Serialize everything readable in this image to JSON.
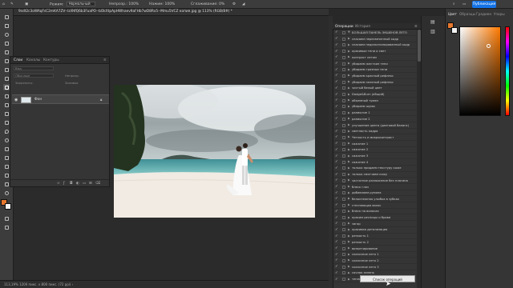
{
  "options_bar": {
    "mode_label": "Режим:",
    "mode_value": "Нормальный",
    "opacity_label": "Непрозр.:",
    "opacity_value": "100%",
    "flow_label": "Нажим:",
    "flow_value": "100%",
    "smoothing_label": "Сглаживание:",
    "smoothing_value": "0%",
    "publish_label": "Публикация"
  },
  "document": {
    "tab_title": "9sdt2c3oWAqFsC2mKA7ZV--lzi9tfQ6b3FuaPO--bOkXtpApHWhaev9aFHb7wD8Rx5--Mmu5VCZ копия.jpg @ 113% (RGB/8#) *"
  },
  "status_bar": {
    "text": "113,19%    1200 пикс. x 800 пикс. (72 ppi)    ›"
  },
  "layers_panel": {
    "tabs": [
      "Слои",
      "Каналы",
      "Контуры"
    ],
    "active_tab": "Слои",
    "kind_label": "Вид",
    "blend_label": "Обычные",
    "opacity_label": "Непрозр.",
    "lock_label": "Закрепить:",
    "fill_label": "Заливка",
    "layer": {
      "name": "Фон"
    }
  },
  "actions_panel": {
    "tabs": [
      "Операции",
      "История"
    ],
    "active_tab": "Операции",
    "top_item": "БОЛЬШАЯ ПАНЕЛЬ ЭКШЕНОВ ЛЕТО",
    "items": [
      "спасаем пересвеченный кадр",
      "спасаем недоэкспонированный кадр",
      "красивые тени и свет",
      "контраст летом",
      "убираем жесткие тени",
      "убираем грязные тени",
      "убираем красный рефлекс",
      "убираем зеленый рефлекс",
      "чистый белый цвет",
      "Dodge&Burn (общий)",
      "объемный туман",
      "убираем шумы",
      "размытие 1",
      "размытие 2",
      "улучшение цвета (цветовой баланс)",
      "светлость кадра",
      "Четкость и микроконтраст",
      "сажатие 1",
      "сажатие 2",
      "сажатие 3",
      "сажатие 4",
      "только придаем текстуру коже",
      "только смягчаем кожу",
      "частотное разложение без плагина",
      "блеск глаз",
      "добавляем румяна",
      "белоснежная улыбка в зубках",
      "стесняющая волос",
      "блеск на волосах",
      "красим ресницы и брови",
      "загар",
      "красивая детализация",
      "резкость 1",
      "резкость 2",
      "виньетирование",
      "сказочное лето 1",
      "сказочное лето 2",
      "сказочное лето 3",
      "сочная зелень",
      "теплое лето"
    ],
    "tooltip": "Список операций"
  },
  "color_panel": {
    "tabs": [
      "Цвет",
      "Образцы",
      "Градиен",
      "Узоры"
    ],
    "active_tab": "Цвет",
    "foreground": "#e6782e",
    "background": "#f2f2f2"
  },
  "colors": {
    "accent": "#1473e6",
    "foreground_swatch": "#e6782e"
  }
}
